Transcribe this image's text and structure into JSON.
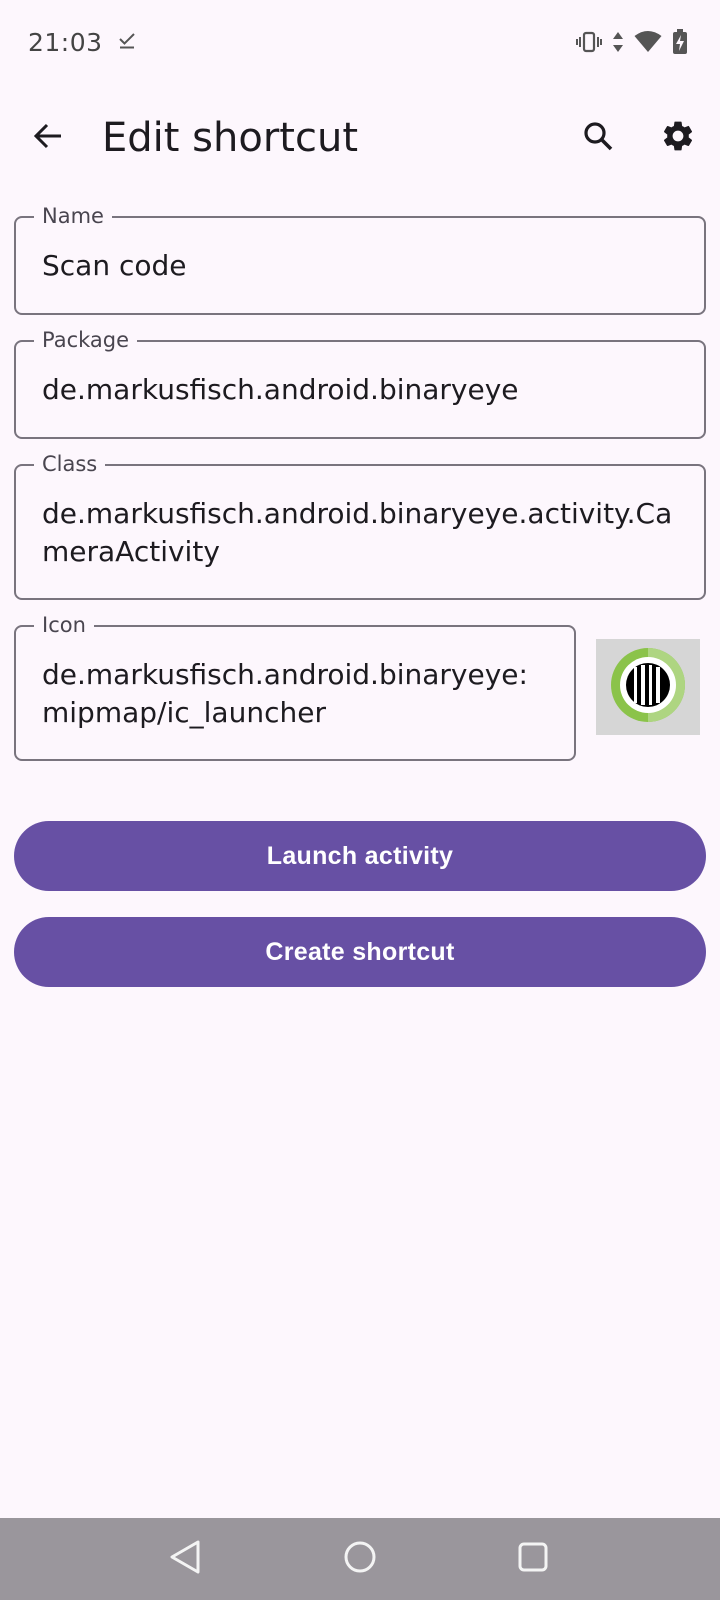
{
  "status_bar": {
    "time": "21:03"
  },
  "app_bar": {
    "title": "Edit shortcut"
  },
  "fields": {
    "name": {
      "label": "Name",
      "value": "Scan code"
    },
    "package": {
      "label": "Package",
      "value": "de.markusfisch.android.binaryeye"
    },
    "class": {
      "label": "Class",
      "value": "de.markusfisch.android.binaryeye.activity.CameraActivity"
    },
    "icon": {
      "label": "Icon",
      "value": "de.markusfisch.android.binaryeye:mipmap/ic_launcher"
    }
  },
  "buttons": {
    "launch": "Launch activity",
    "create": "Create shortcut"
  },
  "colors": {
    "primary": "#6750a4",
    "background": "#fdf7fd",
    "outline": "#79747e",
    "nav_bar": "#9a969c"
  },
  "icons": {
    "back": "arrow-back-icon",
    "search": "search-icon",
    "settings": "gear-icon",
    "app_icon": "barcode-launcher-icon"
  }
}
